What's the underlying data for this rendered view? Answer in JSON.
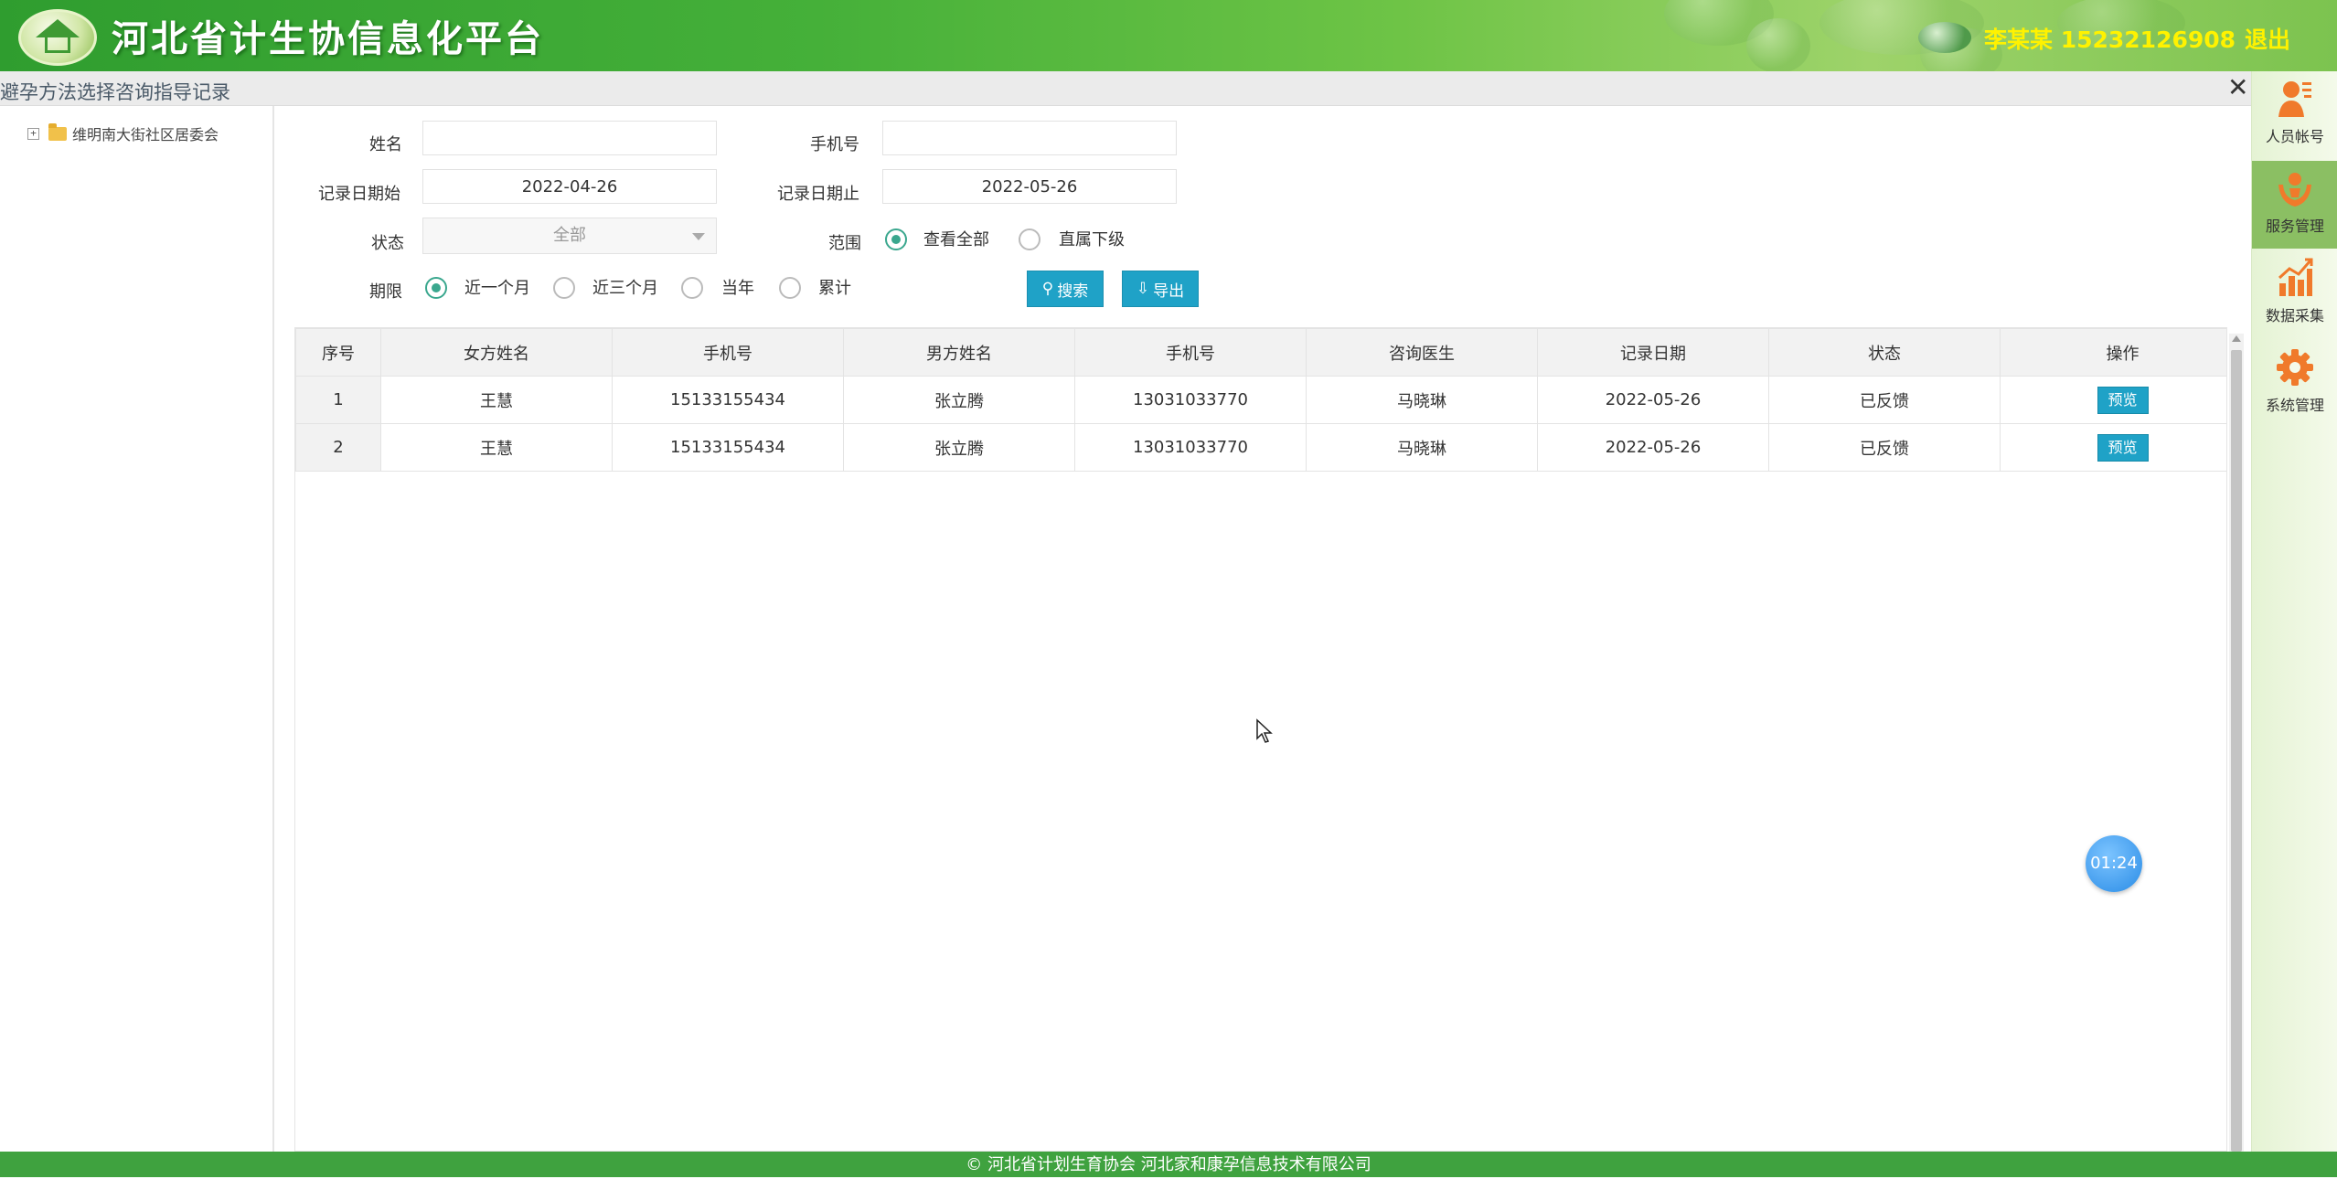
{
  "header": {
    "title": "河北省计生协信息化平台",
    "user_info": "李某某 15232126908",
    "logout_label": "退出"
  },
  "page": {
    "title": "避孕方法选择咨询指导记录"
  },
  "tree": {
    "root_label": "维明南大街社区居委会",
    "expander": "+"
  },
  "form": {
    "name_label": "姓名",
    "name_value": "",
    "phone_label": "手机号",
    "phone_value": "",
    "date_start_label": "记录日期始",
    "date_start_value": "2022-04-26",
    "date_end_label": "记录日期止",
    "date_end_value": "2022-05-26",
    "status_label": "状态",
    "status_value": "全部",
    "scope_label": "范围",
    "scope_options": [
      "查看全部",
      "直属下级"
    ],
    "scope_selected": 0,
    "period_label": "期限",
    "period_options": [
      "近一个月",
      "近三个月",
      "当年",
      "累计"
    ],
    "period_selected": 0,
    "search_label": "搜索",
    "export_label": "导出"
  },
  "table": {
    "columns": [
      "序号",
      "女方姓名",
      "手机号",
      "男方姓名",
      "手机号",
      "咨询医生",
      "记录日期",
      "状态",
      "操作"
    ],
    "rows": [
      {
        "idx": "1",
        "female_name": "王慧",
        "female_phone": "15133155434",
        "male_name": "张立腾",
        "male_phone": "13031033770",
        "doctor": "马晓琳",
        "date": "2022-05-26",
        "status": "已反馈",
        "action": "预览"
      },
      {
        "idx": "2",
        "female_name": "王慧",
        "female_phone": "15133155434",
        "male_name": "张立腾",
        "male_phone": "13031033770",
        "doctor": "马晓琳",
        "date": "2022-05-26",
        "status": "已反馈",
        "action": "预览"
      }
    ]
  },
  "sidebar": {
    "items": [
      {
        "label": "人员帐号",
        "icon": "person-icon"
      },
      {
        "label": "服务管理",
        "icon": "hands-icon"
      },
      {
        "label": "数据采集",
        "icon": "bar-chart-icon"
      },
      {
        "label": "系统管理",
        "icon": "gear-icon"
      }
    ],
    "active_index": 1
  },
  "timer": {
    "value": "01:24"
  },
  "footer": {
    "text": "© 河北省计划生育协会    河北家和康孕信息技术有限公司"
  },
  "colors": {
    "header_green": "#3fa23f",
    "accent_blue": "#1fa2c7",
    "radio_green": "#3aa78e",
    "user_yellow": "#fff200"
  }
}
